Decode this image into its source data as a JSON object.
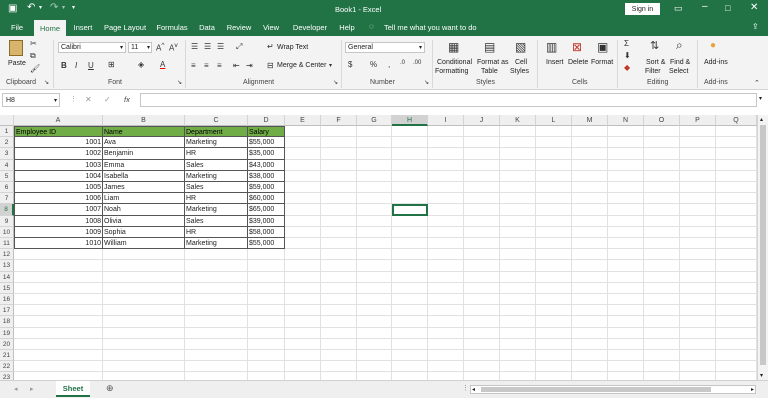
{
  "titlebar": {
    "title": "Book1  -  Excel",
    "signin": "Sign in",
    "quick_access": [
      "save-icon",
      "undo-icon",
      "redo-icon",
      "customize-icon"
    ]
  },
  "menu": [
    "File",
    "Home",
    "Insert",
    "Page Layout",
    "Formulas",
    "Data",
    "Review",
    "View",
    "Developer",
    "Help"
  ],
  "tell_me": "Tell me what you want to do",
  "ribbon": {
    "paste": "Paste",
    "clipboard": "Clipboard",
    "font_name": "Calibri",
    "font_size": "11",
    "font": "Font",
    "wrap_text": "Wrap Text",
    "merge_center": "Merge & Center",
    "alignment": "Alignment",
    "number_format": "General",
    "number": "Number",
    "conditional": "Conditional",
    "formatting": "Formatting",
    "format_as": "Format as",
    "table": "Table",
    "cell": "Cell",
    "styles_lbl": "Styles",
    "styles": "Styles",
    "insert": "Insert",
    "delete": "Delete",
    "format": "Format",
    "cells": "Cells",
    "sort_filter": "Sort &",
    "filter": "Filter",
    "find_select": "Find &",
    "select": "Select",
    "editing": "Editing",
    "addins": "Add-ins",
    "addins_group": "Add-ins"
  },
  "namebox": "H8",
  "fx": "fx",
  "columns": [
    "A",
    "B",
    "C",
    "D",
    "E",
    "F",
    "G",
    "H",
    "I",
    "J",
    "K",
    "L",
    "M",
    "N",
    "O",
    "P",
    "Q"
  ],
  "rows": [
    "1",
    "2",
    "3",
    "4",
    "5",
    "6",
    "7",
    "8",
    "9",
    "10",
    "11",
    "12",
    "13",
    "14",
    "15",
    "16",
    "17",
    "18",
    "19",
    "20",
    "21",
    "22",
    "23"
  ],
  "table": {
    "headers": [
      "Employee ID",
      "Name",
      "Department",
      "Salary"
    ],
    "rows": [
      [
        "1001",
        "Ava",
        "Marketing",
        "$55,000"
      ],
      [
        "1002",
        "Benjamin",
        "HR",
        "$35,000"
      ],
      [
        "1003",
        "Emma",
        "Sales",
        "$43,000"
      ],
      [
        "1004",
        "Isabella",
        "Marketing",
        "$38,000"
      ],
      [
        "1005",
        "James",
        "Sales",
        "$59,000"
      ],
      [
        "1006",
        "Liam",
        "HR",
        "$60,000"
      ],
      [
        "1007",
        "Noah",
        "Marketing",
        "$65,000"
      ],
      [
        "1008",
        "Olivia",
        "Sales",
        "$39,000"
      ],
      [
        "1009",
        "Sophia",
        "HR",
        "$58,000"
      ],
      [
        "1010",
        "William",
        "Marketing",
        "$55,000"
      ]
    ]
  },
  "sheet_tab": "Sheet",
  "colors": {
    "brand": "#217346",
    "header_fill": "#70ad47",
    "selection": "#217346"
  }
}
